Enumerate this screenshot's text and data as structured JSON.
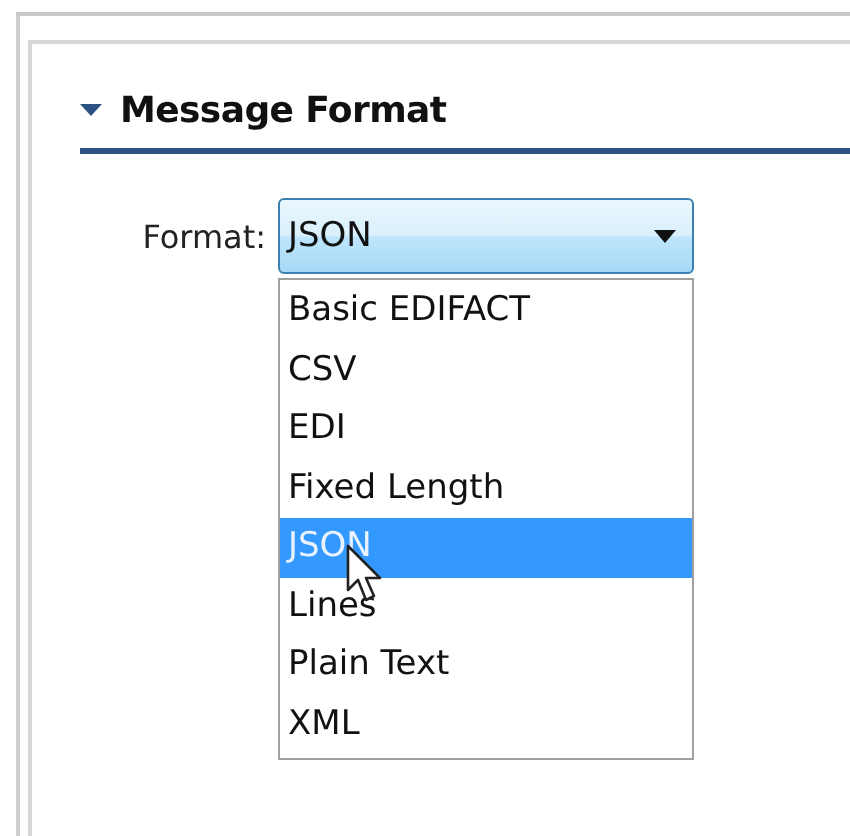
{
  "section": {
    "title": "Message Format",
    "expanded": true
  },
  "format": {
    "label": "Format:",
    "value": "JSON",
    "open": true,
    "options": [
      {
        "label": "Basic EDIFACT",
        "selected": false
      },
      {
        "label": "CSV",
        "selected": false
      },
      {
        "label": "EDI",
        "selected": false
      },
      {
        "label": "Fixed Length",
        "selected": false
      },
      {
        "label": "JSON",
        "selected": true
      },
      {
        "label": "Lines",
        "selected": false
      },
      {
        "label": "Plain Text",
        "selected": false
      },
      {
        "label": "XML",
        "selected": false
      }
    ]
  }
}
